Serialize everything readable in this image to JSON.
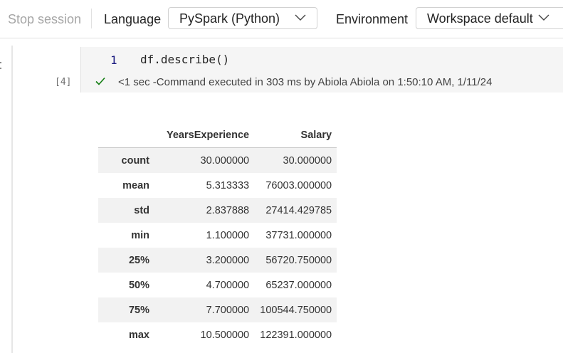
{
  "toolbar": {
    "stop_session": "Stop session",
    "language_label": "Language",
    "language_value": "PySpark (Python)",
    "environment_label": "Environment",
    "environment_value": "Workspace default"
  },
  "cell": {
    "line_number": "1",
    "code": "df.describe()",
    "execution_count": "[4]",
    "status": "<1 sec -Command executed in 303 ms by Abiola Abiola on 1:50:10 AM, 1/11/24"
  },
  "table": {
    "columns": [
      "",
      "YearsExperience",
      "Salary"
    ],
    "rows": [
      {
        "label": "count",
        "years": "30.000000",
        "salary": "30.000000"
      },
      {
        "label": "mean",
        "years": "5.313333",
        "salary": "76003.000000"
      },
      {
        "label": "std",
        "years": "2.837888",
        "salary": "27414.429785"
      },
      {
        "label": "min",
        "years": "1.100000",
        "salary": "37731.000000"
      },
      {
        "label": "25%",
        "years": "3.200000",
        "salary": "56720.750000"
      },
      {
        "label": "50%",
        "years": "4.700000",
        "salary": "65237.000000"
      },
      {
        "label": "75%",
        "years": "7.700000",
        "salary": "100544.750000"
      },
      {
        "label": "max",
        "years": "10.500000",
        "salary": "122391.000000"
      }
    ]
  },
  "colors": {
    "success": "#107c10",
    "disabled_text": "#a6a6a6",
    "row_stripe": "#f2f2f2"
  }
}
